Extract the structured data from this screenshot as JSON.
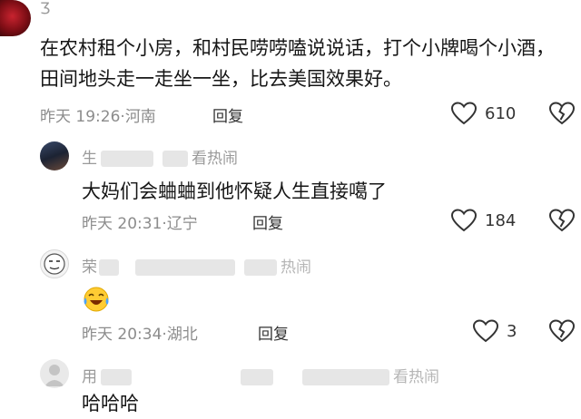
{
  "comments": [
    {
      "name_fragment": "Ʒ",
      "text": "在农村租个小房，和村民唠唠嗑说说话，打个小牌喝个小酒，田间地头走一走坐一坐，比去美国效果好。",
      "time": "昨天 19:26",
      "location": "河南",
      "reply_label": "回复",
      "likes": "610"
    },
    {
      "name_fragment": "生",
      "name_suffix": "看热闹",
      "text": "大妈们会蛐蛐到他怀疑人生直接噶了",
      "time": "昨天 20:31",
      "location": "辽宁",
      "reply_label": "回复",
      "likes": "184"
    },
    {
      "name_fragment": "荣",
      "name_suffix": "热闹",
      "text": "",
      "emoji": "laughing-crying-emoji",
      "time": "昨天 20:34",
      "location": "湖北",
      "reply_label": "回复",
      "likes": "3"
    },
    {
      "name_fragment": "用",
      "name_suffix": "看热闹",
      "text": "哈哈哈"
    }
  ],
  "separator": "·",
  "icons": [
    "heart-icon",
    "broken-heart-icon"
  ],
  "colors": {
    "meta": "#8c8c8c",
    "text": "#161616"
  }
}
